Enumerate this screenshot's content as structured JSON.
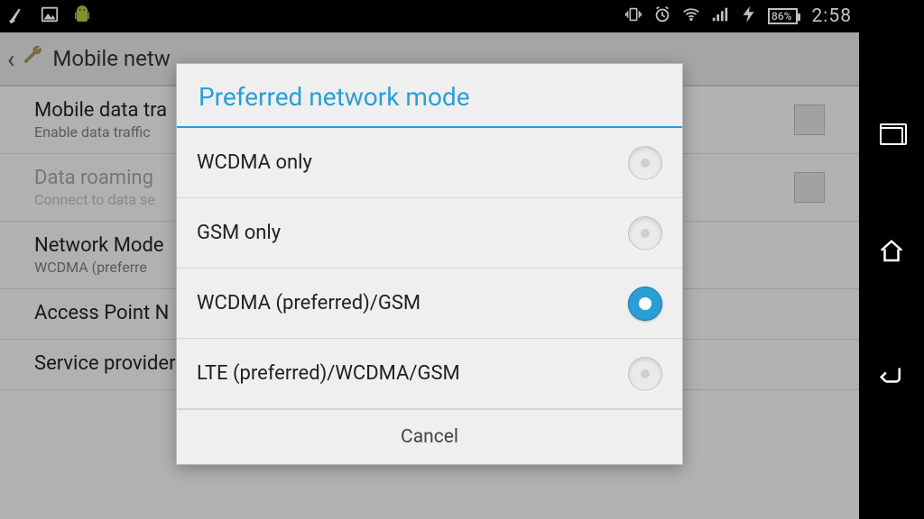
{
  "status": {
    "battery_pct": "86%",
    "clock": "2:58"
  },
  "app_bar": {
    "title": "Mobile netw"
  },
  "settings": {
    "items": [
      {
        "title": "Mobile data tra",
        "sub": "Enable data traffic",
        "checkbox": true,
        "dim": false
      },
      {
        "title": "Data roaming",
        "sub": "Connect to data se",
        "checkbox": true,
        "dim": true
      },
      {
        "title": "Network Mode",
        "sub": "WCDMA (preferre",
        "checkbox": false,
        "dim": false
      },
      {
        "title": "Access Point N",
        "sub": "",
        "checkbox": false,
        "dim": false
      },
      {
        "title": "Service providers",
        "sub": "",
        "checkbox": false,
        "dim": false
      }
    ]
  },
  "dialog": {
    "title": "Preferred network mode",
    "options": [
      {
        "label": "WCDMA only",
        "selected": false
      },
      {
        "label": "GSM only",
        "selected": false
      },
      {
        "label": "WCDMA (preferred)/GSM",
        "selected": true
      },
      {
        "label": "LTE (preferred)/WCDMA/GSM",
        "selected": false
      }
    ],
    "cancel": "Cancel"
  }
}
